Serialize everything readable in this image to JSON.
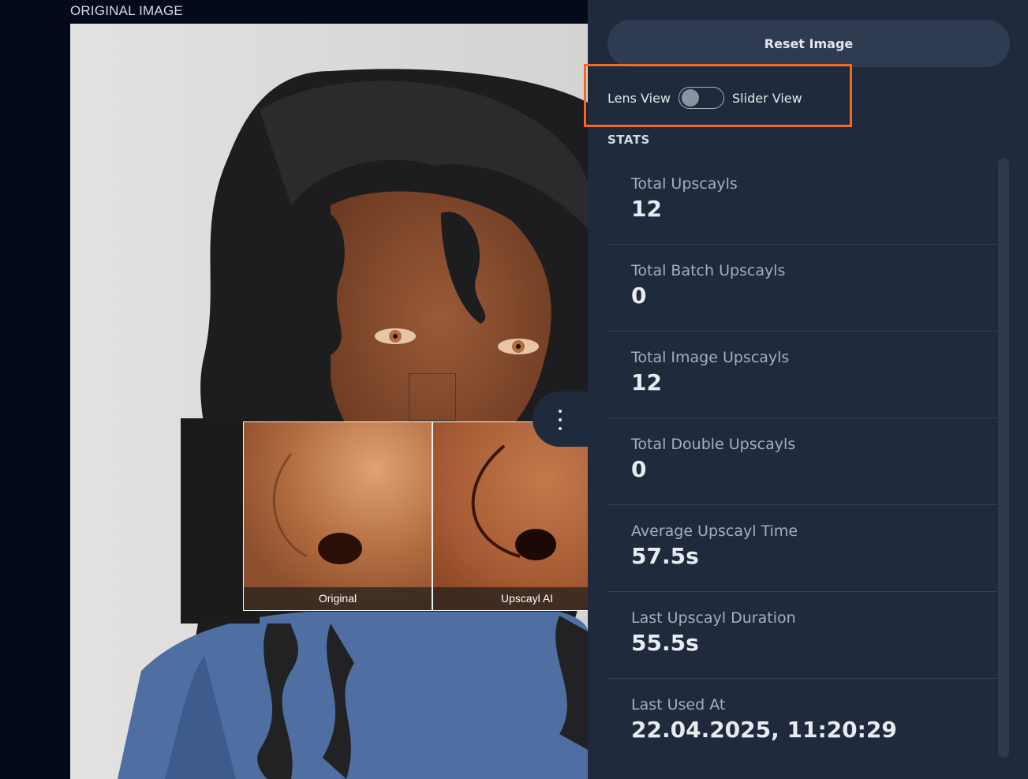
{
  "viewer": {
    "label": "ORIGINAL IMAGE",
    "lens_captions": {
      "original": "Original",
      "upscaled": "Upscayl AI"
    }
  },
  "sidebar": {
    "reset_label": "Reset Image",
    "toggle": {
      "left_label": "Lens View",
      "right_label": "Slider View",
      "state": "off"
    },
    "stats_title": "STATS",
    "stats": [
      {
        "label": "Total Upscayls",
        "value": "12"
      },
      {
        "label": "Total Batch Upscayls",
        "value": "0"
      },
      {
        "label": "Total Image Upscayls",
        "value": "12"
      },
      {
        "label": "Total Double Upscayls",
        "value": "0"
      },
      {
        "label": "Average Upscayl Time",
        "value": "57.5s"
      },
      {
        "label": "Last Upscayl Duration",
        "value": "55.5s"
      },
      {
        "label": "Last Used At",
        "value": "22.04.2025, 11:20:29"
      }
    ]
  },
  "colors": {
    "background": "#050a1a",
    "sidebar": "#1f2a3d",
    "highlight": "#f26a1b"
  },
  "icons": {
    "sidebar_toggle": "more-vertical-icon"
  }
}
